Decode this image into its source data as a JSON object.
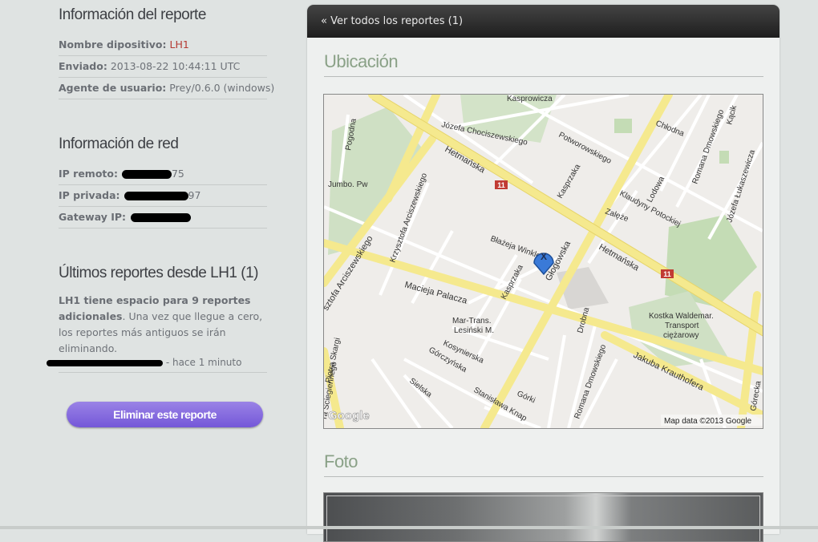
{
  "report_info": {
    "title": "Información del reporte",
    "device_label": "Nombre dipositivo:",
    "device_value": "LH1",
    "sent_label": "Enviado:",
    "sent_value": "2013-08-22 10:44:11 UTC",
    "agent_label": "Agente de usuario:",
    "agent_value": "Prey/0.6.0 (windows)"
  },
  "network_info": {
    "title": "Información de red",
    "remote_ip_label": "IP remoto:",
    "remote_ip_visible_suffix": "75",
    "private_ip_label": "IP privada:",
    "private_ip_visible_suffix": "97",
    "gateway_label": "Gateway IP:"
  },
  "recent_reports": {
    "title": "Últimos reportes desde LH1 (1)",
    "capacity_bold": "LH1 tiene espacio para 9 reportes adicionales",
    "capacity_rest": ". Una vez que llegue a cero, los reportes más antiguos se irán eliminando.",
    "entry_time": "- hace 1 minuto"
  },
  "actions": {
    "delete_label": "Eliminar este reporte"
  },
  "panel": {
    "back_link": "« Ver todos los reportes (1)",
    "location_title": "Ubicación",
    "photo_title": "Foto"
  },
  "map": {
    "attribution": "Map data ©2013 Google",
    "logo": "Google",
    "marker_label": "X",
    "route_badge": "11",
    "streets": {
      "hetmanska": "Hetmańska",
      "hetmanska2": "Hetmańska",
      "glogowska": "Głogowska",
      "macieja": "Macieja Palacza",
      "jakuba": "Jakuba Krauthofera",
      "arciszewskiego": "Krzysztofa Arciszewskiego",
      "arcisz2": "sztofa Arciszewskiego",
      "chociszewskiego": "Józefa Chociszewskiego",
      "potworowskiego": "Potworowskiego",
      "klaudyny": "Klaudyny Potockiej",
      "kasprowicza": "Kasprowicza",
      "chlodna": "Chłodna",
      "romana_top": "Romana Dmowskiego",
      "romana_bottom": "Romana Dmowskiego",
      "lukaszewicza": "Józefa Łukaszewicza",
      "blazeja": "Błażeja Winkler",
      "kasprzaka": "Kasprzaka",
      "kasprzaka2": "Kasprzaka",
      "lodowa": "Lodowa",
      "zalęze": "Zalęże",
      "drobna": "Drobna",
      "gorki": "Górki",
      "gorczynska": "Górczyńska",
      "kosynierska": "Kosynierska",
      "stanislawa": "Stanisława Knap",
      "sielska": "Sielska",
      "skargi": "Piotra Skargi",
      "scieg": "ra Ściegiennego",
      "pogodna": "Pogodna",
      "kacik": "Kącik",
      "gorecka": "Górecka"
    },
    "pois": {
      "jumbo": "Jumbo. Pw",
      "mar_trans_1": "Mar-Trans.",
      "mar_trans_2": "Lesiński M.",
      "kostka_1": "Kostka Waldemar.",
      "kostka_2": "Transport",
      "kostka_3": "ciężarowy"
    }
  }
}
